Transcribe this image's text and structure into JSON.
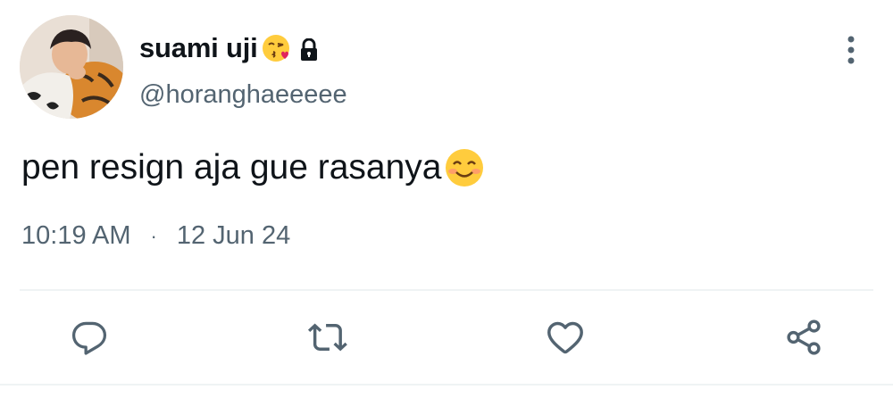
{
  "user": {
    "display_name": "suami uji",
    "handle": "@horanghaeeeee",
    "name_emoji": "face-blowing-a-kiss-emoji",
    "protected_icon": "lock-icon"
  },
  "tweet": {
    "text": "pen resign aja gue rasanya",
    "trailing_emoji": "smiling-face-emoji",
    "time": "10:19 AM",
    "separator": "·",
    "date": "12 Jun 24"
  },
  "actions": [
    {
      "name": "reply",
      "icon": "reply-icon"
    },
    {
      "name": "retweet",
      "icon": "retweet-icon"
    },
    {
      "name": "like",
      "icon": "heart-icon"
    },
    {
      "name": "share",
      "icon": "share-icon"
    }
  ],
  "colors": {
    "text_primary": "#0f1419",
    "text_secondary": "#536471",
    "icon": "#536471",
    "divider": "#eff3f4"
  }
}
